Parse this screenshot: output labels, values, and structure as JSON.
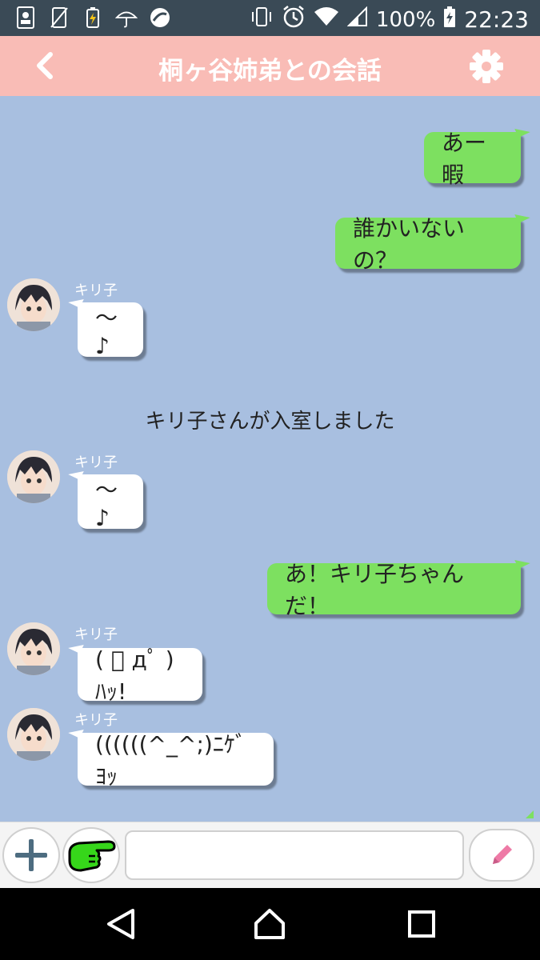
{
  "status_bar": {
    "battery_percent": "100%",
    "time": "22:23",
    "left_icons": [
      "contacts-icon",
      "no-phone-icon",
      "battery-charging-icon",
      "umbrella-weather-icon",
      "app-swirl-icon"
    ],
    "right_icons": [
      "vibrate-icon",
      "alarm-icon",
      "wifi-icon",
      "signal-icon",
      "battery-icon"
    ]
  },
  "header": {
    "title": "桐ヶ谷姉弟との会話",
    "background": "#f9bcb6"
  },
  "messages": [
    {
      "side": "me",
      "text": "あー暇"
    },
    {
      "side": "me",
      "text": "誰かいないの？"
    },
    {
      "side": "other",
      "name": "キリ子",
      "text": "～♪"
    },
    {
      "side": "system",
      "text": "キリ子さんが入室しました"
    },
    {
      "side": "other",
      "name": "キリ子",
      "text": "～♪"
    },
    {
      "side": "me",
      "text": "あ！キリ子ちゃんだ！"
    },
    {
      "side": "other",
      "name": "キリ子",
      "text": "( ﾟ дﾟ )ﾊｯ!"
    },
    {
      "side": "other",
      "name": "キリ子",
      "text": "((((((^_^;)ﾆｹﾞﾖｯ"
    }
  ],
  "input": {
    "value": "",
    "placeholder": ""
  },
  "colors": {
    "chat_background": "#a8bfe0",
    "my_bubble": "#7de060",
    "other_bubble": "#ffffff",
    "pen_accent": "#ee7aa6"
  }
}
